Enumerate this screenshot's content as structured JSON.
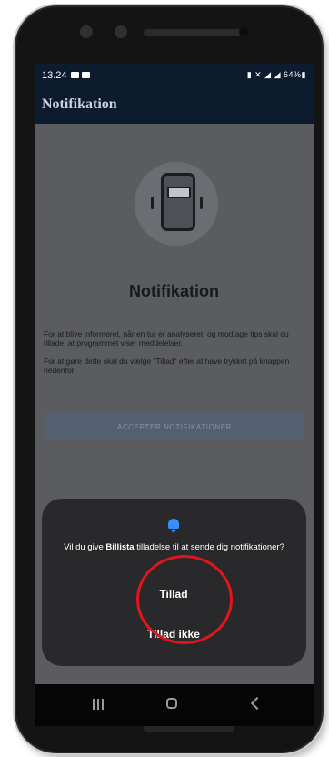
{
  "status_bar": {
    "time": "13.24",
    "right_text": "▮ ✕ ◢ ◢ 64%▮"
  },
  "app_bar": {
    "title": "Notifikation"
  },
  "main": {
    "heading": "Notifikation",
    "paragraph_1": "For at blive informeret, når en tur er analyseret, og modtage tips skal du tillade, at programmet viser meddelelser.",
    "paragraph_2": "For at gøre dette skal du vælge \"Tillad\" efter at have trykket på knappen nedenfor.",
    "accept_button": "ACCEPTER NOTIFIKATIONER"
  },
  "dialog": {
    "message_pre": "Vil du give ",
    "message_app": "Billista",
    "message_post": " tilladelse til at sende dig notifikationer?",
    "allow_label": "Tillad",
    "deny_label": "Tillad ikke"
  },
  "colors": {
    "app_bar": "#0c1b2d",
    "dialog_bg": "#29292b",
    "bell": "#3a8dff",
    "highlight_circle": "#e4141c"
  }
}
